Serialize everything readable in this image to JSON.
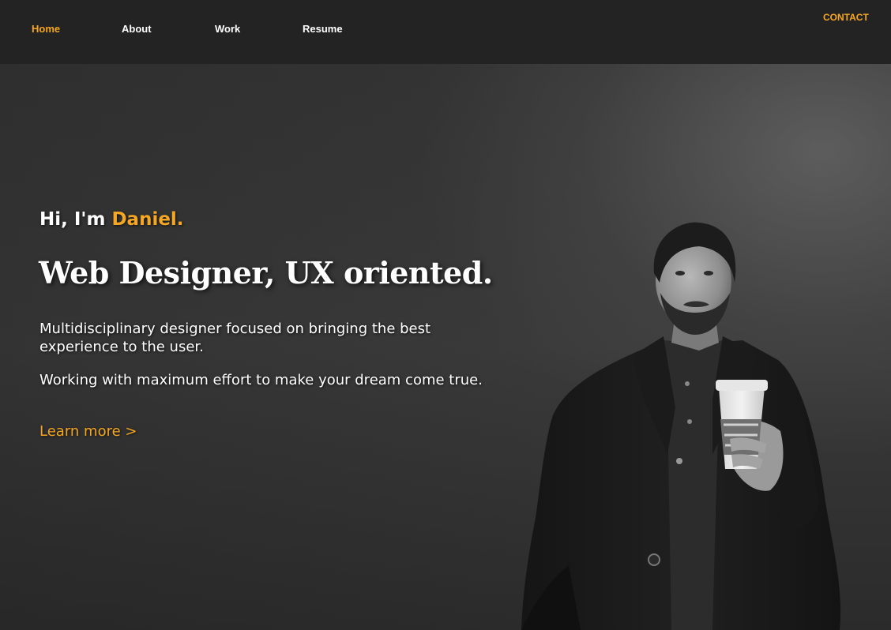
{
  "nav": {
    "home": "Home",
    "about": "About",
    "work": "Work",
    "resume": "Resume",
    "contact": "CONTACT"
  },
  "hero": {
    "greeting_prefix": "Hi, I'm ",
    "greeting_name": "Daniel.",
    "headline": "Web Designer, UX oriented.",
    "paragraph_1": "Multidisciplinary designer focused on bringing the best experience to the user.",
    "paragraph_2": "Working with maximum effort to make your dream come true.",
    "learn_more": "Learn more >"
  },
  "colors": {
    "accent": "#f5a623",
    "nav_background": "#232323",
    "text": "#ffffff"
  }
}
